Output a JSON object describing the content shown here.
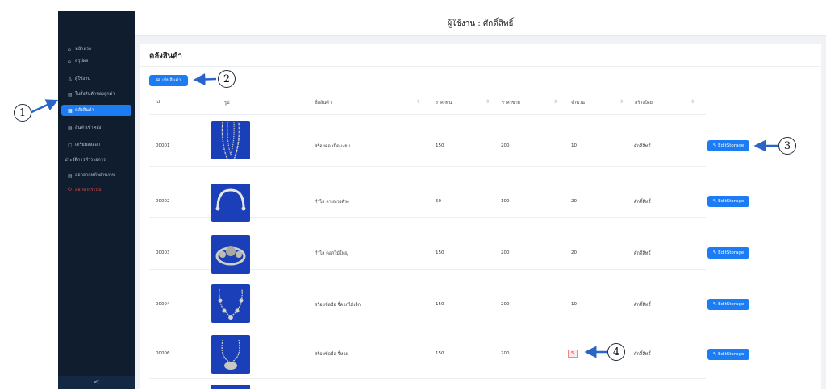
{
  "sidebar": {
    "items": [
      {
        "icon": "home-icon",
        "label": "หน้าแรก"
      },
      {
        "icon": "summary-icon",
        "label": "สรุปผล"
      },
      {
        "icon": "user-icon",
        "label": "ผู้ใช้งาน"
      },
      {
        "icon": "document-icon",
        "label": "ใบสั่งสินค้าของลูกค้า"
      },
      {
        "icon": "warehouse-icon",
        "label": "คลังสินค้า",
        "active": true
      },
      {
        "icon": "inbound-icon",
        "label": "สินค้าเข้าคลัง"
      },
      {
        "icon": "document-icon",
        "label": "เตรียมส่งออก"
      },
      {
        "icon": "",
        "label": "ประวัติการทำรายการ"
      },
      {
        "icon": "document-icon",
        "label": "ออกจากหน้าผ่านงาน"
      },
      {
        "icon": "power-icon",
        "label": "ออกจากระบบ",
        "danger": true
      }
    ],
    "collapse_label": "<"
  },
  "header": {
    "title": "ผู้ใช้งาน : ศักดิ์สิทธิ์"
  },
  "page": {
    "title": "คลังสินค้า",
    "add_button": "เพิ่มสินค้า",
    "add_icon": "⊞"
  },
  "table": {
    "columns": [
      "Id",
      "รูป",
      "ชื่อสินค้า",
      "ราคาทุน",
      "ราคาขาย",
      "จำนวน",
      "สร้างโดย"
    ],
    "edit_label": "✎ EditStorage",
    "rows": [
      {
        "id": "00001",
        "name": "สร้อยคอ เม็ดมะยม",
        "cost": "150",
        "price": "200",
        "qty": "10",
        "by": "ศักดิ์สิทธิ์",
        "img": "necklace"
      },
      {
        "id": "00002",
        "name": "กำไล ลายพวงตัวง",
        "cost": "50",
        "price": "100",
        "qty": "20",
        "by": "ศักดิ์สิทธิ์",
        "img": "bangle"
      },
      {
        "id": "00003",
        "name": "กำไล ดอกไม้ใหญ่",
        "cost": "150",
        "price": "200",
        "qty": "20",
        "by": "ศักดิ์สิทธิ์",
        "img": "flower"
      },
      {
        "id": "00004",
        "name": "สร้อยข้อมือ จี้ดอกไม้เล็ก",
        "cost": "150",
        "price": "200",
        "qty": "10",
        "by": "ศักดิ์สิทธิ์",
        "img": "charm"
      },
      {
        "id": "00006",
        "name": "สร้อยข้อมือ จี้หอย",
        "cost": "150",
        "price": "200",
        "qty": "5",
        "by": "ศักดิ์สิทธิ์",
        "img": "shell",
        "low_stock": true
      }
    ]
  },
  "callouts": [
    "1",
    "2",
    "3",
    "4"
  ],
  "colors": {
    "sidebar_bg": "#0f1d2e",
    "accent": "#1c7cf3",
    "danger": "#e14b4b",
    "photo_bg": "#1b3fb8"
  }
}
